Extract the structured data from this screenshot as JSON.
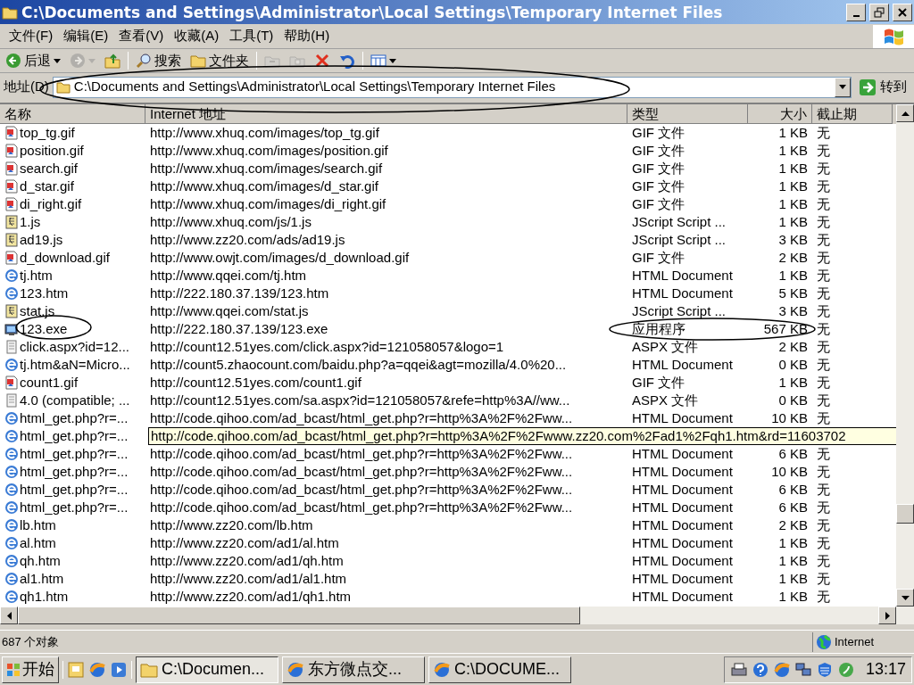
{
  "window": {
    "title": "C:\\Documents and Settings\\Administrator\\Local Settings\\Temporary Internet Files"
  },
  "menu": [
    "文件(F)",
    "编辑(E)",
    "查看(V)",
    "收藏(A)",
    "工具(T)",
    "帮助(H)"
  ],
  "toolbar": [
    {
      "kind": "back",
      "label": "后退",
      "disabled": false
    },
    {
      "kind": "forward",
      "disabled": true
    },
    {
      "kind": "up",
      "disabled": false
    },
    {
      "kind": "search",
      "label": "搜索",
      "disabled": false
    },
    {
      "kind": "folders",
      "label": "文件夹",
      "disabled": false
    },
    {
      "kind": "move",
      "disabled": true
    },
    {
      "kind": "copy",
      "disabled": true
    },
    {
      "kind": "delete",
      "disabled": false
    },
    {
      "kind": "undo",
      "disabled": false
    },
    {
      "kind": "views",
      "disabled": false
    }
  ],
  "address": {
    "label": "地址(D)",
    "value": "C:\\Documents and Settings\\Administrator\\Local Settings\\Temporary Internet Files",
    "go": "转到"
  },
  "columns": [
    "名称",
    "Internet 地址",
    "类型",
    "大小",
    "截止期"
  ],
  "rows": [
    {
      "kind": "gif",
      "name": "top_tg.gif",
      "url": "http://www.xhuq.com/images/top_tg.gif",
      "type": "GIF 文件",
      "size": "1 KB",
      "expires": "无"
    },
    {
      "kind": "gif",
      "name": "position.gif",
      "url": "http://www.xhuq.com/images/position.gif",
      "type": "GIF 文件",
      "size": "1 KB",
      "expires": "无"
    },
    {
      "kind": "gif",
      "name": "search.gif",
      "url": "http://www.xhuq.com/images/search.gif",
      "type": "GIF 文件",
      "size": "1 KB",
      "expires": "无"
    },
    {
      "kind": "gif",
      "name": "d_star.gif",
      "url": "http://www.xhuq.com/images/d_star.gif",
      "type": "GIF 文件",
      "size": "1 KB",
      "expires": "无"
    },
    {
      "kind": "gif",
      "name": "di_right.gif",
      "url": "http://www.xhuq.com/images/di_right.gif",
      "type": "GIF 文件",
      "size": "1 KB",
      "expires": "无"
    },
    {
      "kind": "js",
      "name": "1.js",
      "url": "http://www.xhuq.com/js/1.js",
      "type": "JScript Script ...",
      "size": "1 KB",
      "expires": "无"
    },
    {
      "kind": "js",
      "name": "ad19.js",
      "url": "http://www.zz20.com/ads/ad19.js",
      "type": "JScript Script ...",
      "size": "3 KB",
      "expires": "无"
    },
    {
      "kind": "gif",
      "name": "d_download.gif",
      "url": "http://www.owjt.com/images/d_download.gif",
      "type": "GIF 文件",
      "size": "2 KB",
      "expires": "无"
    },
    {
      "kind": "htm",
      "name": "tj.htm",
      "url": "http://www.qqei.com/tj.htm",
      "type": "HTML Document",
      "size": "1 KB",
      "expires": "无"
    },
    {
      "kind": "htm",
      "name": "123.htm",
      "url": "http://222.180.37.139/123.htm",
      "type": "HTML Document",
      "size": "5 KB",
      "expires": "无"
    },
    {
      "kind": "js",
      "name": "stat.js",
      "url": "http://www.qqei.com/stat.js",
      "type": "JScript Script ...",
      "size": "3 KB",
      "expires": "无"
    },
    {
      "kind": "exe",
      "name": "123.exe",
      "url": "http://222.180.37.139/123.exe",
      "type": "应用程序",
      "size": "567 KB",
      "expires": "无"
    },
    {
      "kind": "aspx",
      "name": "click.aspx?id=12...",
      "url": "http://count12.51yes.com/click.aspx?id=121058057&logo=1",
      "type": "ASPX 文件",
      "size": "2 KB",
      "expires": "无"
    },
    {
      "kind": "htm",
      "name": "tj.htm&aN=Micro...",
      "url": "http://count5.zhaocount.com/baidu.php?a=qqei&agt=mozilla/4.0%20...",
      "type": "HTML Document",
      "size": "0 KB",
      "expires": "无"
    },
    {
      "kind": "gif",
      "name": "count1.gif",
      "url": "http://count12.51yes.com/count1.gif",
      "type": "GIF 文件",
      "size": "1 KB",
      "expires": "无"
    },
    {
      "kind": "aspx",
      "name": "4.0 (compatible; ...",
      "url": "http://count12.51yes.com/sa.aspx?id=121058057&refe=http%3A//ww...",
      "type": "ASPX 文件",
      "size": "0 KB",
      "expires": "无"
    },
    {
      "kind": "htm",
      "name": "html_get.php?r=...",
      "url": "http://code.qihoo.com/ad_bcast/html_get.php?r=http%3A%2F%2Fww...",
      "type": "HTML Document",
      "size": "10 KB",
      "expires": "无"
    },
    {
      "kind": "htm",
      "name": "html_get.php?r=...",
      "tooltip": "http://code.qihoo.com/ad_bcast/html_get.php?r=http%3A%2F%2Fwww.zz20.com%2Fad1%2Fqh1.htm&rd=11603702"
    },
    {
      "kind": "htm",
      "name": "html_get.php?r=...",
      "url": "http://code.qihoo.com/ad_bcast/html_get.php?r=http%3A%2F%2Fww...",
      "type": "HTML Document",
      "size": "6 KB",
      "expires": "无"
    },
    {
      "kind": "htm",
      "name": "html_get.php?r=...",
      "url": "http://code.qihoo.com/ad_bcast/html_get.php?r=http%3A%2F%2Fww...",
      "type": "HTML Document",
      "size": "10 KB",
      "expires": "无"
    },
    {
      "kind": "htm",
      "name": "html_get.php?r=...",
      "url": "http://code.qihoo.com/ad_bcast/html_get.php?r=http%3A%2F%2Fww...",
      "type": "HTML Document",
      "size": "6 KB",
      "expires": "无"
    },
    {
      "kind": "htm",
      "name": "html_get.php?r=...",
      "url": "http://code.qihoo.com/ad_bcast/html_get.php?r=http%3A%2F%2Fww...",
      "type": "HTML Document",
      "size": "6 KB",
      "expires": "无"
    },
    {
      "kind": "htm",
      "name": "lb.htm",
      "url": "http://www.zz20.com/lb.htm",
      "type": "HTML Document",
      "size": "2 KB",
      "expires": "无"
    },
    {
      "kind": "htm",
      "name": "al.htm",
      "url": "http://www.zz20.com/ad1/al.htm",
      "type": "HTML Document",
      "size": "1 KB",
      "expires": "无"
    },
    {
      "kind": "htm",
      "name": "qh.htm",
      "url": "http://www.zz20.com/ad1/qh.htm",
      "type": "HTML Document",
      "size": "1 KB",
      "expires": "无"
    },
    {
      "kind": "htm",
      "name": "al1.htm",
      "url": "http://www.zz20.com/ad1/al1.htm",
      "type": "HTML Document",
      "size": "1 KB",
      "expires": "无"
    },
    {
      "kind": "htm",
      "name": "qh1.htm",
      "url": "http://www.zz20.com/ad1/qh1.htm",
      "type": "HTML Document",
      "size": "1 KB",
      "expires": "无"
    }
  ],
  "status_bar": {
    "count": "687 个对象",
    "zone": "Internet"
  },
  "taskbar": {
    "start": "开始",
    "tasks": [
      {
        "kind": "folder",
        "label": "C:\\Documen...",
        "selected": true
      },
      {
        "kind": "browser",
        "label": "东方微点交...",
        "selected": false
      },
      {
        "kind": "browser",
        "label": "C:\\DOCUME...",
        "selected": false
      }
    ],
    "clock": "13:17"
  }
}
